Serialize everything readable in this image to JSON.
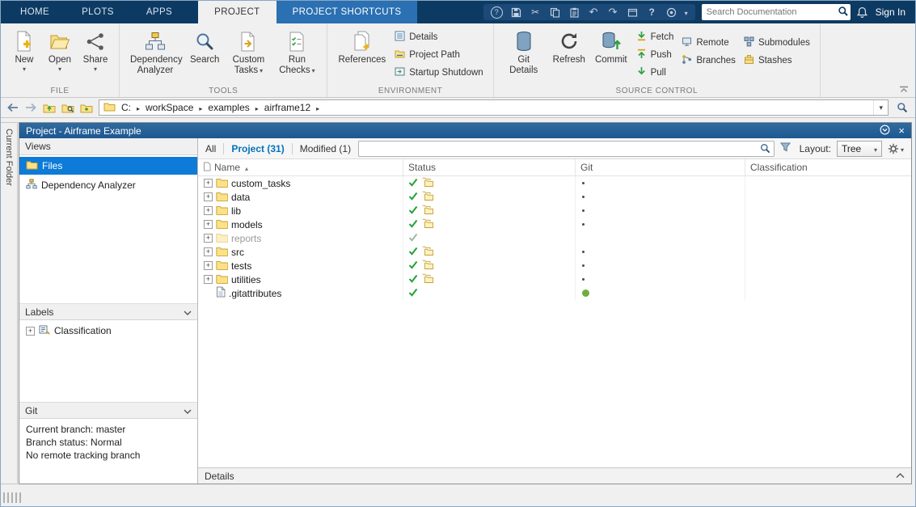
{
  "tabbar": {
    "tabs": [
      "HOME",
      "PLOTS",
      "APPS",
      "PROJECT",
      "PROJECT SHORTCUTS"
    ],
    "active_tab": "PROJECT",
    "search": {
      "placeholder": "Search Documentation"
    },
    "signin_label": "Sign In"
  },
  "ribbon": {
    "file": {
      "label": "FILE",
      "new": "New",
      "open": "Open",
      "share": "Share"
    },
    "tools": {
      "label": "TOOLS",
      "dependency_analyzer": "Dependency Analyzer",
      "search": "Search",
      "custom_tasks": "Custom Tasks",
      "run_checks": "Run Checks"
    },
    "environment": {
      "label": "ENVIRONMENT",
      "references": "References",
      "details": "Details",
      "project_path": "Project Path",
      "startup_shutdown": "Startup Shutdown"
    },
    "source_control": {
      "label": "SOURCE CONTROL",
      "git_details": "Git Details",
      "refresh": "Refresh",
      "commit": "Commit",
      "fetch": "Fetch",
      "push": "Push",
      "pull": "Pull",
      "remote": "Remote",
      "branches": "Branches",
      "submodules": "Submodules",
      "stashes": "Stashes"
    }
  },
  "addressbar": {
    "breadcrumb": [
      "C:",
      "workSpace",
      "examples",
      "airframe12"
    ]
  },
  "window": {
    "current_folder_strip": "Current Folder"
  },
  "panel": {
    "title": "Project - Airframe Example",
    "toolbar": {
      "filters": [
        "All",
        "Project (31)",
        "Modified (1)"
      ],
      "active_filter": "Project (31)",
      "layout_label": "Layout:",
      "layout_value": "Tree"
    },
    "sidebar": {
      "views_header": "Views",
      "items": [
        {
          "label": "Files",
          "selected": true
        },
        {
          "label": "Dependency Analyzer",
          "selected": false
        }
      ],
      "labels_header": "Labels",
      "labels_items": [
        "Classification"
      ],
      "git_header": "Git",
      "git_info": [
        "Current branch: master",
        "Branch status: Normal",
        "No remote tracking branch"
      ]
    },
    "table": {
      "columns": [
        "Name",
        "Status",
        "Git",
        "Classification"
      ],
      "sort_column": "Name",
      "sort_direction": "ascending",
      "rows": [
        {
          "name": "custom_tasks",
          "kind": "folder",
          "status": "check_folders",
          "git": "dot"
        },
        {
          "name": "data",
          "kind": "folder",
          "status": "check_folders",
          "git": "dot"
        },
        {
          "name": "lib",
          "kind": "folder",
          "status": "check_folders",
          "git": "dot"
        },
        {
          "name": "models",
          "kind": "folder",
          "status": "check_folders",
          "git": "dot"
        },
        {
          "name": "reports",
          "kind": "folder",
          "dim": true,
          "status": "check_dim",
          "git": "none"
        },
        {
          "name": "src",
          "kind": "folder",
          "status": "check_folders",
          "git": "dot"
        },
        {
          "name": "tests",
          "kind": "folder",
          "status": "check_folders",
          "git": "dot"
        },
        {
          "name": "utilities",
          "kind": "folder",
          "status": "check_folders",
          "git": "dot"
        },
        {
          "name": ".gitattributes",
          "kind": "file",
          "status": "check",
          "git": "green"
        }
      ]
    },
    "details_label": "Details"
  },
  "colors": {
    "toolstrip_bg": "#0d3a62",
    "accent_blue": "#0072bd",
    "selection_blue": "#0d7bd7",
    "check_green": "#21A038",
    "git_dot_green": "#6FAE3D"
  }
}
